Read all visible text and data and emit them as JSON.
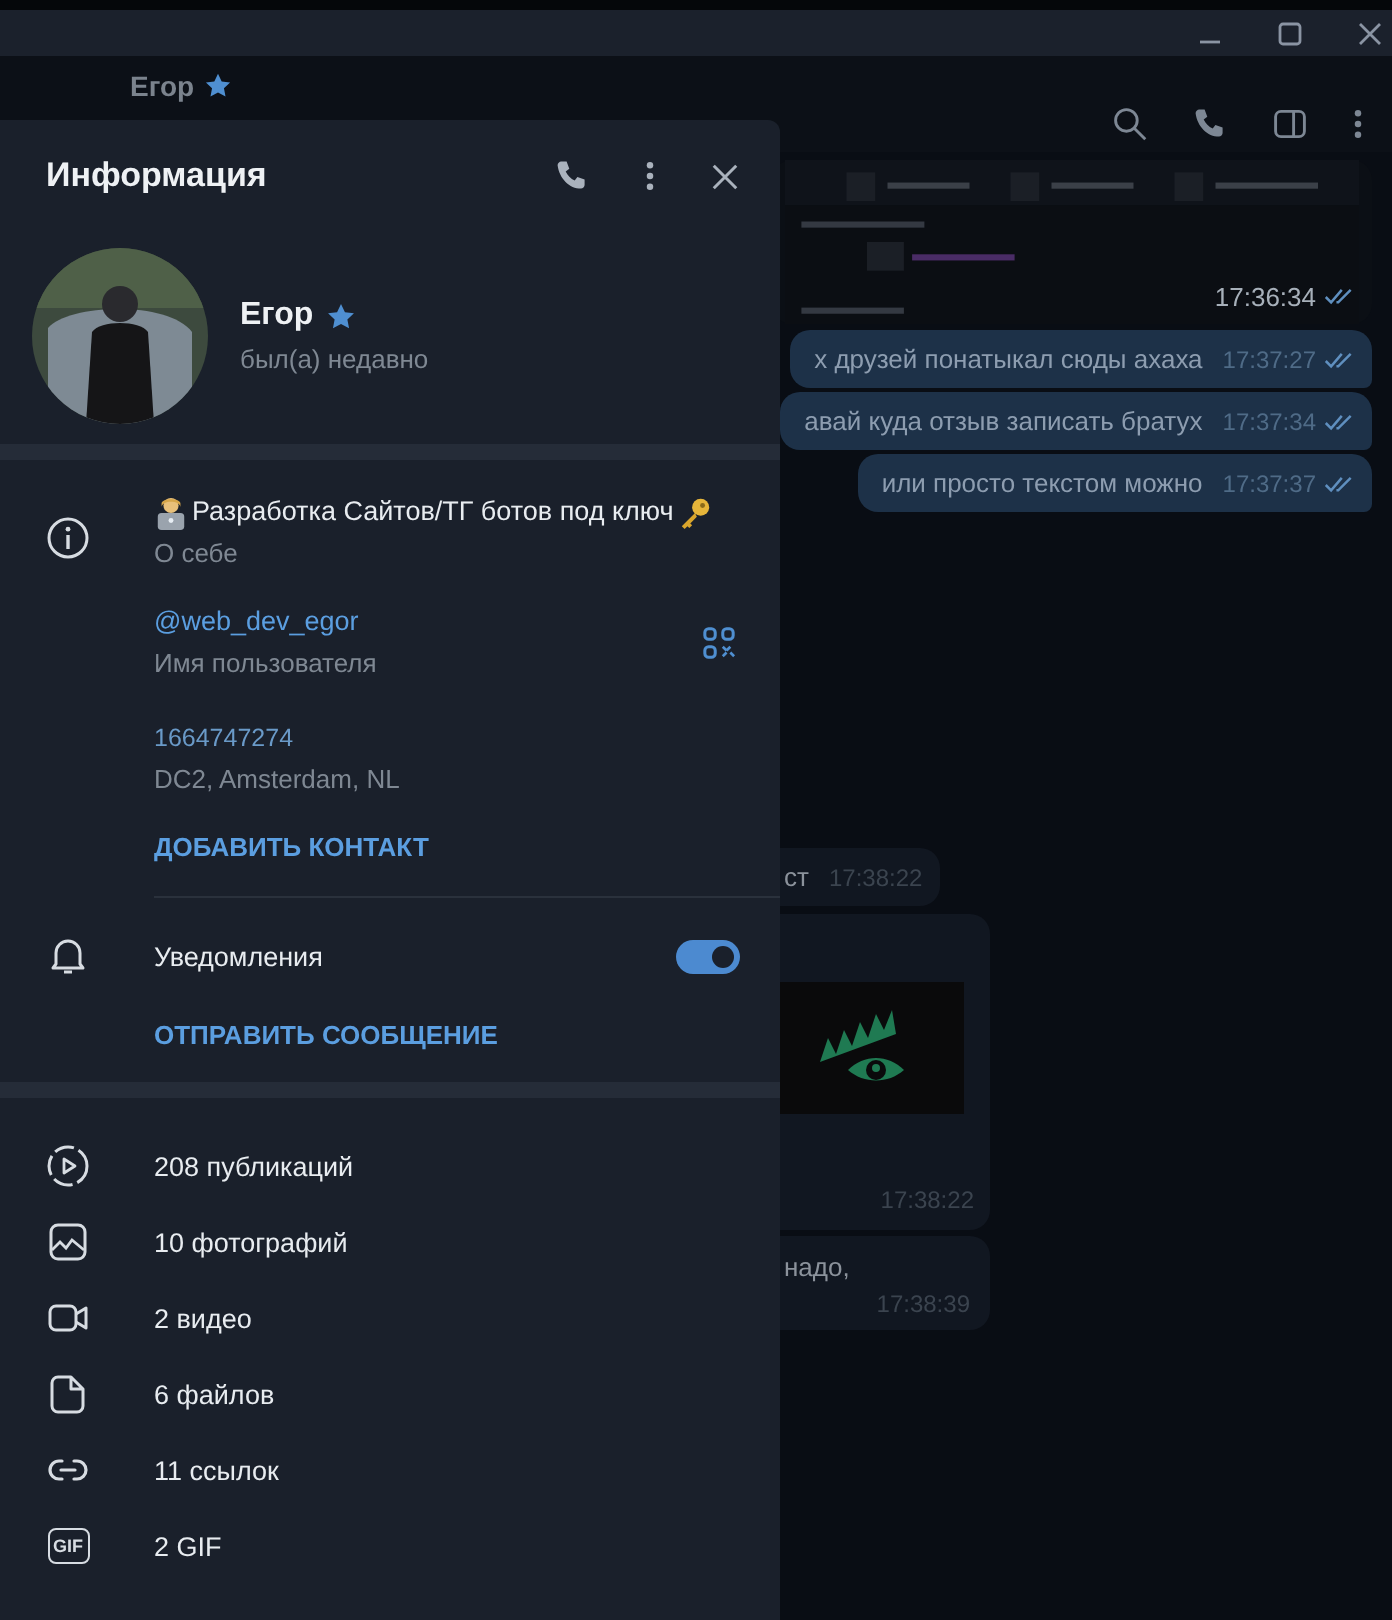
{
  "chat_header": {
    "name": "Егор"
  },
  "messages": [
    {
      "kind": "outgoing_image",
      "time": "17:36:34",
      "read": true
    },
    {
      "kind": "outgoing_text",
      "text": "х друзей понатыкал сюды ахаха",
      "time": "17:37:27",
      "read": true
    },
    {
      "kind": "outgoing_text",
      "text": "авай куда отзыв записать братух",
      "time": "17:37:34",
      "read": true
    },
    {
      "kind": "outgoing_text",
      "text": "или просто текстом можно",
      "time": "17:37:37",
      "read": true
    },
    {
      "kind": "incoming_text",
      "text": "ст",
      "time": "17:38:22"
    },
    {
      "kind": "incoming_image",
      "time": "17:38:22"
    },
    {
      "kind": "incoming_text",
      "text": "надо,",
      "time": "17:38:39"
    }
  ],
  "panel": {
    "title": "Информация",
    "profile": {
      "name": "Егор",
      "status": "был(а) недавно"
    },
    "info": [
      {
        "kind": "bio",
        "value": "Разработка Сайтов/ТГ ботов под ключ",
        "label": "О себе"
      },
      {
        "kind": "username",
        "value": "@web_dev_egor",
        "label": "Имя пользователя"
      },
      {
        "kind": "id",
        "value": "1664747274",
        "label": "DC2, Amsterdam, NL"
      }
    ],
    "add_contact": "ДОБАВИТЬ КОНТАКТ",
    "notifications": {
      "label": "Уведомления",
      "on": true
    },
    "send_message": "ОТПРАВИТЬ СООБЩЕНИЕ",
    "media": [
      {
        "kind": "posts",
        "label": "208 публикаций"
      },
      {
        "kind": "photos",
        "label": "10 фотографий"
      },
      {
        "kind": "videos",
        "label": "2 видео"
      },
      {
        "kind": "files",
        "label": "6 файлов"
      },
      {
        "kind": "links",
        "label": "11 ссылок"
      },
      {
        "kind": "gif",
        "label": "2 GIF",
        "icon_text": "GIF"
      }
    ]
  }
}
